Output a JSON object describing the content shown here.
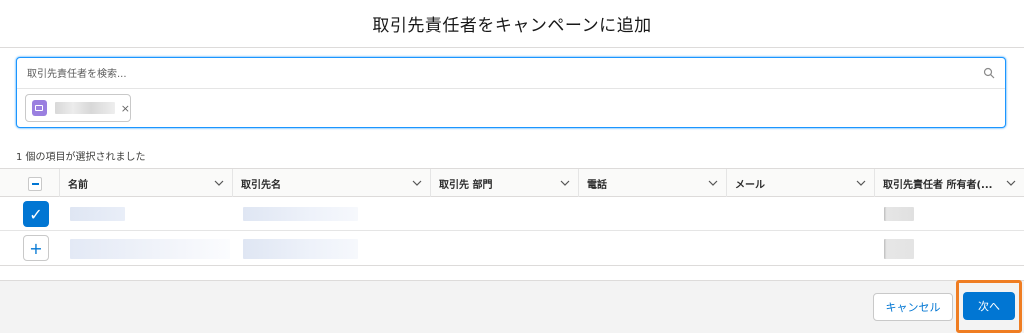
{
  "modal": {
    "title": "取引先責任者をキャンペーンに追加"
  },
  "search": {
    "placeholder": "取引先責任者を検索...",
    "value": ""
  },
  "selected_pill": {
    "close_glyph": "×"
  },
  "selection_count": "1 個の項目が選択されました",
  "table": {
    "columns": [
      "名前",
      "取引先名",
      "取引先 部門",
      "電話",
      "メール",
      "取引先責任者 所有者(..."
    ],
    "rows": [
      {
        "selected": true,
        "button_glyph": "✓"
      },
      {
        "selected": false,
        "button_glyph": "+"
      }
    ]
  },
  "footer": {
    "cancel_label": "キャンセル",
    "next_label": "次へ"
  },
  "colors": {
    "brand": "#0176d3",
    "highlight": "#ef7d22",
    "contact_icon": "#9a7fe0"
  },
  "icons": [
    "search-icon",
    "contact-icon",
    "close-icon",
    "chevron-down-icon",
    "checkmark-icon",
    "plus-icon",
    "minus-icon"
  ]
}
